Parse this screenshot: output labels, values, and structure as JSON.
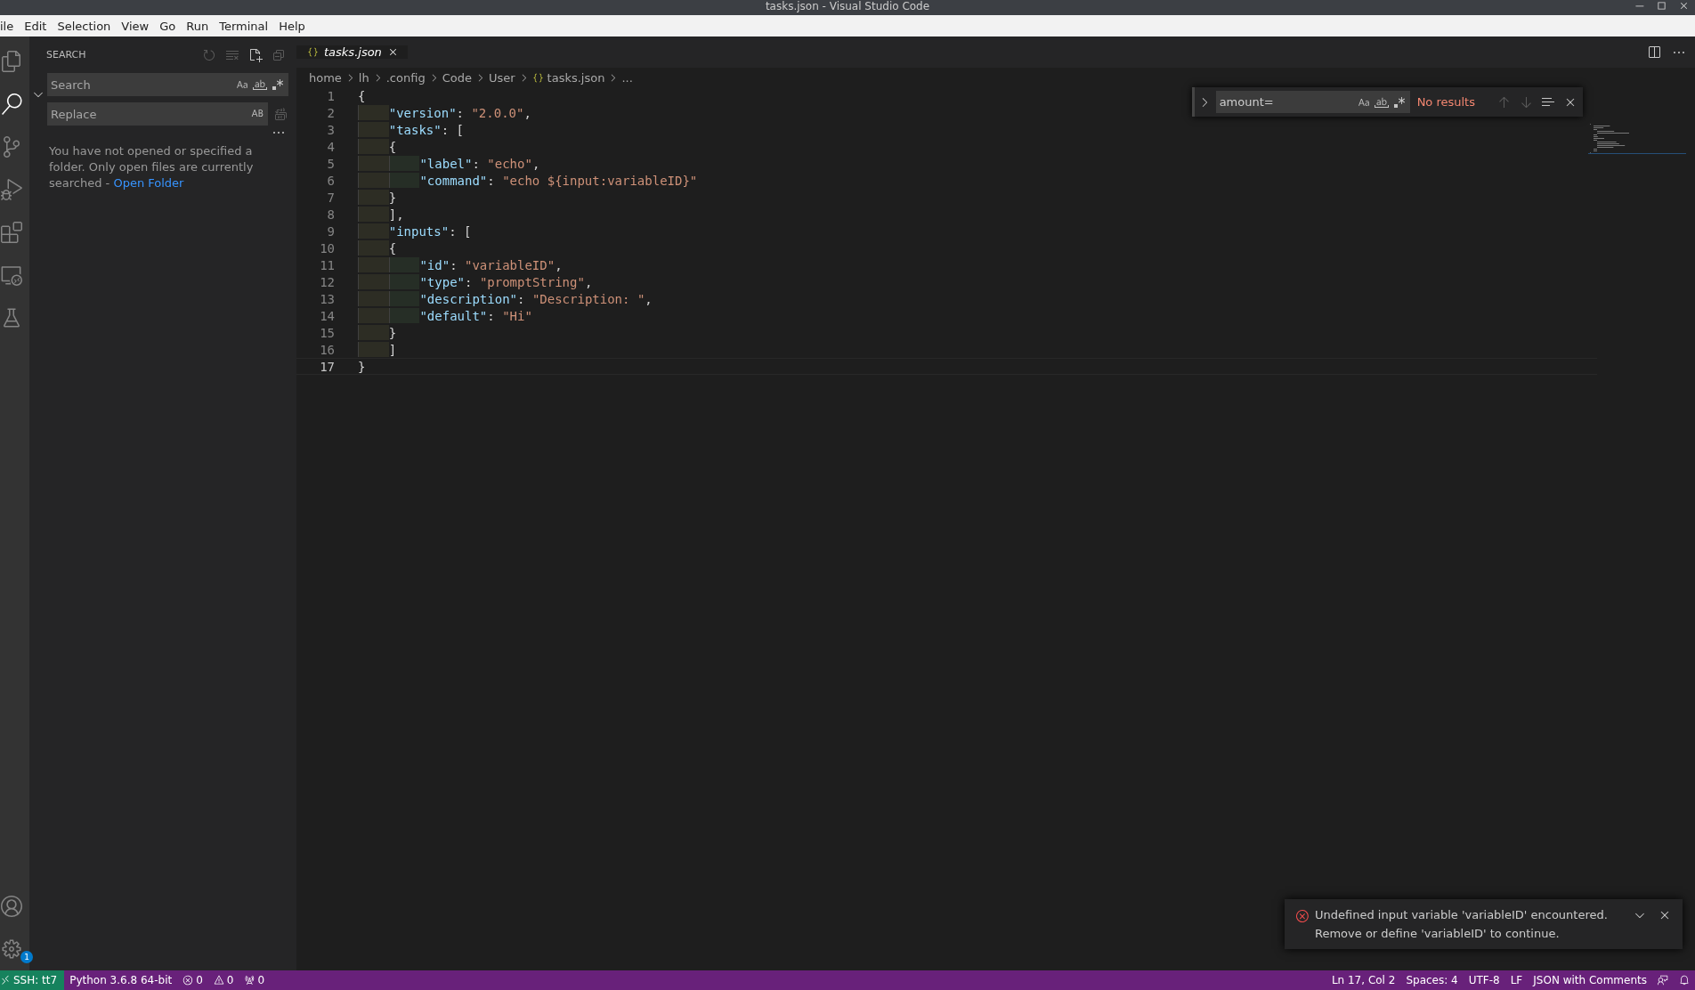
{
  "window": {
    "title": "tasks.json - Visual Studio Code"
  },
  "menu": [
    "ile",
    "Edit",
    "Selection",
    "View",
    "Go",
    "Run",
    "Terminal",
    "Help"
  ],
  "activity_bar": {
    "items": [
      {
        "kind": "files",
        "selected": false
      },
      {
        "kind": "search",
        "selected": true
      },
      {
        "kind": "source-control",
        "selected": false
      },
      {
        "kind": "run",
        "selected": false
      },
      {
        "kind": "extensions",
        "selected": false
      },
      {
        "kind": "remote",
        "selected": false
      },
      {
        "kind": "testing",
        "selected": false
      }
    ],
    "bottom": [
      {
        "kind": "account"
      },
      {
        "kind": "settings",
        "badge": "1"
      }
    ]
  },
  "sidebar": {
    "title": "SEARCH",
    "search": {
      "placeholder": "Search"
    },
    "replace": {
      "placeholder": "Replace"
    },
    "expanded": true,
    "message": "You have not opened or specified a folder. Only open files are currently searched -",
    "link": "Open Folder"
  },
  "tabs": [
    {
      "label": "tasks.json",
      "selected": true,
      "preview": true
    }
  ],
  "breadcrumbs": [
    {
      "label": "home"
    },
    {
      "label": "lh"
    },
    {
      "label": ".config"
    },
    {
      "label": "Code"
    },
    {
      "label": "User"
    },
    {
      "label": "tasks.json",
      "kind": "json"
    },
    {
      "label": "..."
    }
  ],
  "code": [
    {
      "number": "1",
      "current": false,
      "tokens": [
        {
          "kind": "punct",
          "text": "{"
        }
      ]
    },
    {
      "number": "2",
      "current": false,
      "tokens": [
        {
          "kind": "key",
          "text": "    \"version\""
        },
        {
          "kind": "punct",
          "text": ": "
        },
        {
          "kind": "string",
          "text": "\"2.0.0\""
        },
        {
          "kind": "punct",
          "text": ","
        }
      ]
    },
    {
      "number": "3",
      "current": false,
      "tokens": [
        {
          "kind": "key",
          "text": "    \"tasks\""
        },
        {
          "kind": "punct",
          "text": ": ["
        }
      ]
    },
    {
      "number": "4",
      "current": false,
      "tokens": [
        {
          "kind": "punct",
          "text": "    {"
        }
      ]
    },
    {
      "number": "5",
      "current": false,
      "tokens": [
        {
          "kind": "key",
          "text": "        \"label\""
        },
        {
          "kind": "punct",
          "text": ": "
        },
        {
          "kind": "string",
          "text": "\"echo\""
        },
        {
          "kind": "punct",
          "text": ","
        }
      ]
    },
    {
      "number": "6",
      "current": false,
      "tokens": [
        {
          "kind": "key",
          "text": "        \"command\""
        },
        {
          "kind": "punct",
          "text": ": "
        },
        {
          "kind": "string",
          "text": "\"echo ${input:variableID}\""
        }
      ]
    },
    {
      "number": "7",
      "current": false,
      "tokens": [
        {
          "kind": "punct",
          "text": "    }"
        }
      ]
    },
    {
      "number": "8",
      "current": false,
      "tokens": [
        {
          "kind": "punct",
          "text": "    ],"
        }
      ]
    },
    {
      "number": "9",
      "current": false,
      "tokens": [
        {
          "kind": "key",
          "text": "    \"inputs\""
        },
        {
          "kind": "punct",
          "text": ": ["
        }
      ]
    },
    {
      "number": "10",
      "current": false,
      "tokens": [
        {
          "kind": "punct",
          "text": "    {"
        }
      ]
    },
    {
      "number": "11",
      "current": false,
      "tokens": [
        {
          "kind": "key",
          "text": "        \"id\""
        },
        {
          "kind": "punct",
          "text": ": "
        },
        {
          "kind": "string",
          "text": "\"variableID\""
        },
        {
          "kind": "punct",
          "text": ","
        }
      ]
    },
    {
      "number": "12",
      "current": false,
      "tokens": [
        {
          "kind": "key",
          "text": "        \"type\""
        },
        {
          "kind": "punct",
          "text": ": "
        },
        {
          "kind": "string",
          "text": "\"promptString\""
        },
        {
          "kind": "punct",
          "text": ","
        }
      ]
    },
    {
      "number": "13",
      "current": false,
      "tokens": [
        {
          "kind": "key",
          "text": "        \"description\""
        },
        {
          "kind": "punct",
          "text": ": "
        },
        {
          "kind": "string",
          "text": "\"Description: \""
        },
        {
          "kind": "punct",
          "text": ","
        }
      ]
    },
    {
      "number": "14",
      "current": false,
      "tokens": [
        {
          "kind": "key",
          "text": "        \"default\""
        },
        {
          "kind": "punct",
          "text": ": "
        },
        {
          "kind": "string",
          "text": "\"Hi\""
        }
      ]
    },
    {
      "number": "15",
      "current": false,
      "tokens": [
        {
          "kind": "punct",
          "text": "    }"
        }
      ]
    },
    {
      "number": "16",
      "current": false,
      "tokens": [
        {
          "kind": "punct",
          "text": "    ]"
        }
      ]
    },
    {
      "number": "17",
      "current": true,
      "tokens": [
        {
          "kind": "punct",
          "text": "}"
        }
      ]
    }
  ],
  "find": {
    "value": "amount=",
    "result": "No results"
  },
  "notification": {
    "message": "Undefined input variable 'variableID' encountered.",
    "detail": "Remove or define 'variableID' to continue."
  },
  "status_bar": {
    "remote": "SSH: tt7",
    "left": [
      {
        "kind": "text",
        "text": "Python 3.6.8 64-bit"
      },
      {
        "kind": "errors",
        "text": "0"
      },
      {
        "kind": "warnings",
        "text": "0"
      },
      {
        "kind": "ports",
        "text": "0"
      }
    ],
    "right": [
      "Ln 17, Col 2",
      "Spaces: 4",
      "UTF-8",
      "LF",
      "JSON with Comments"
    ]
  }
}
